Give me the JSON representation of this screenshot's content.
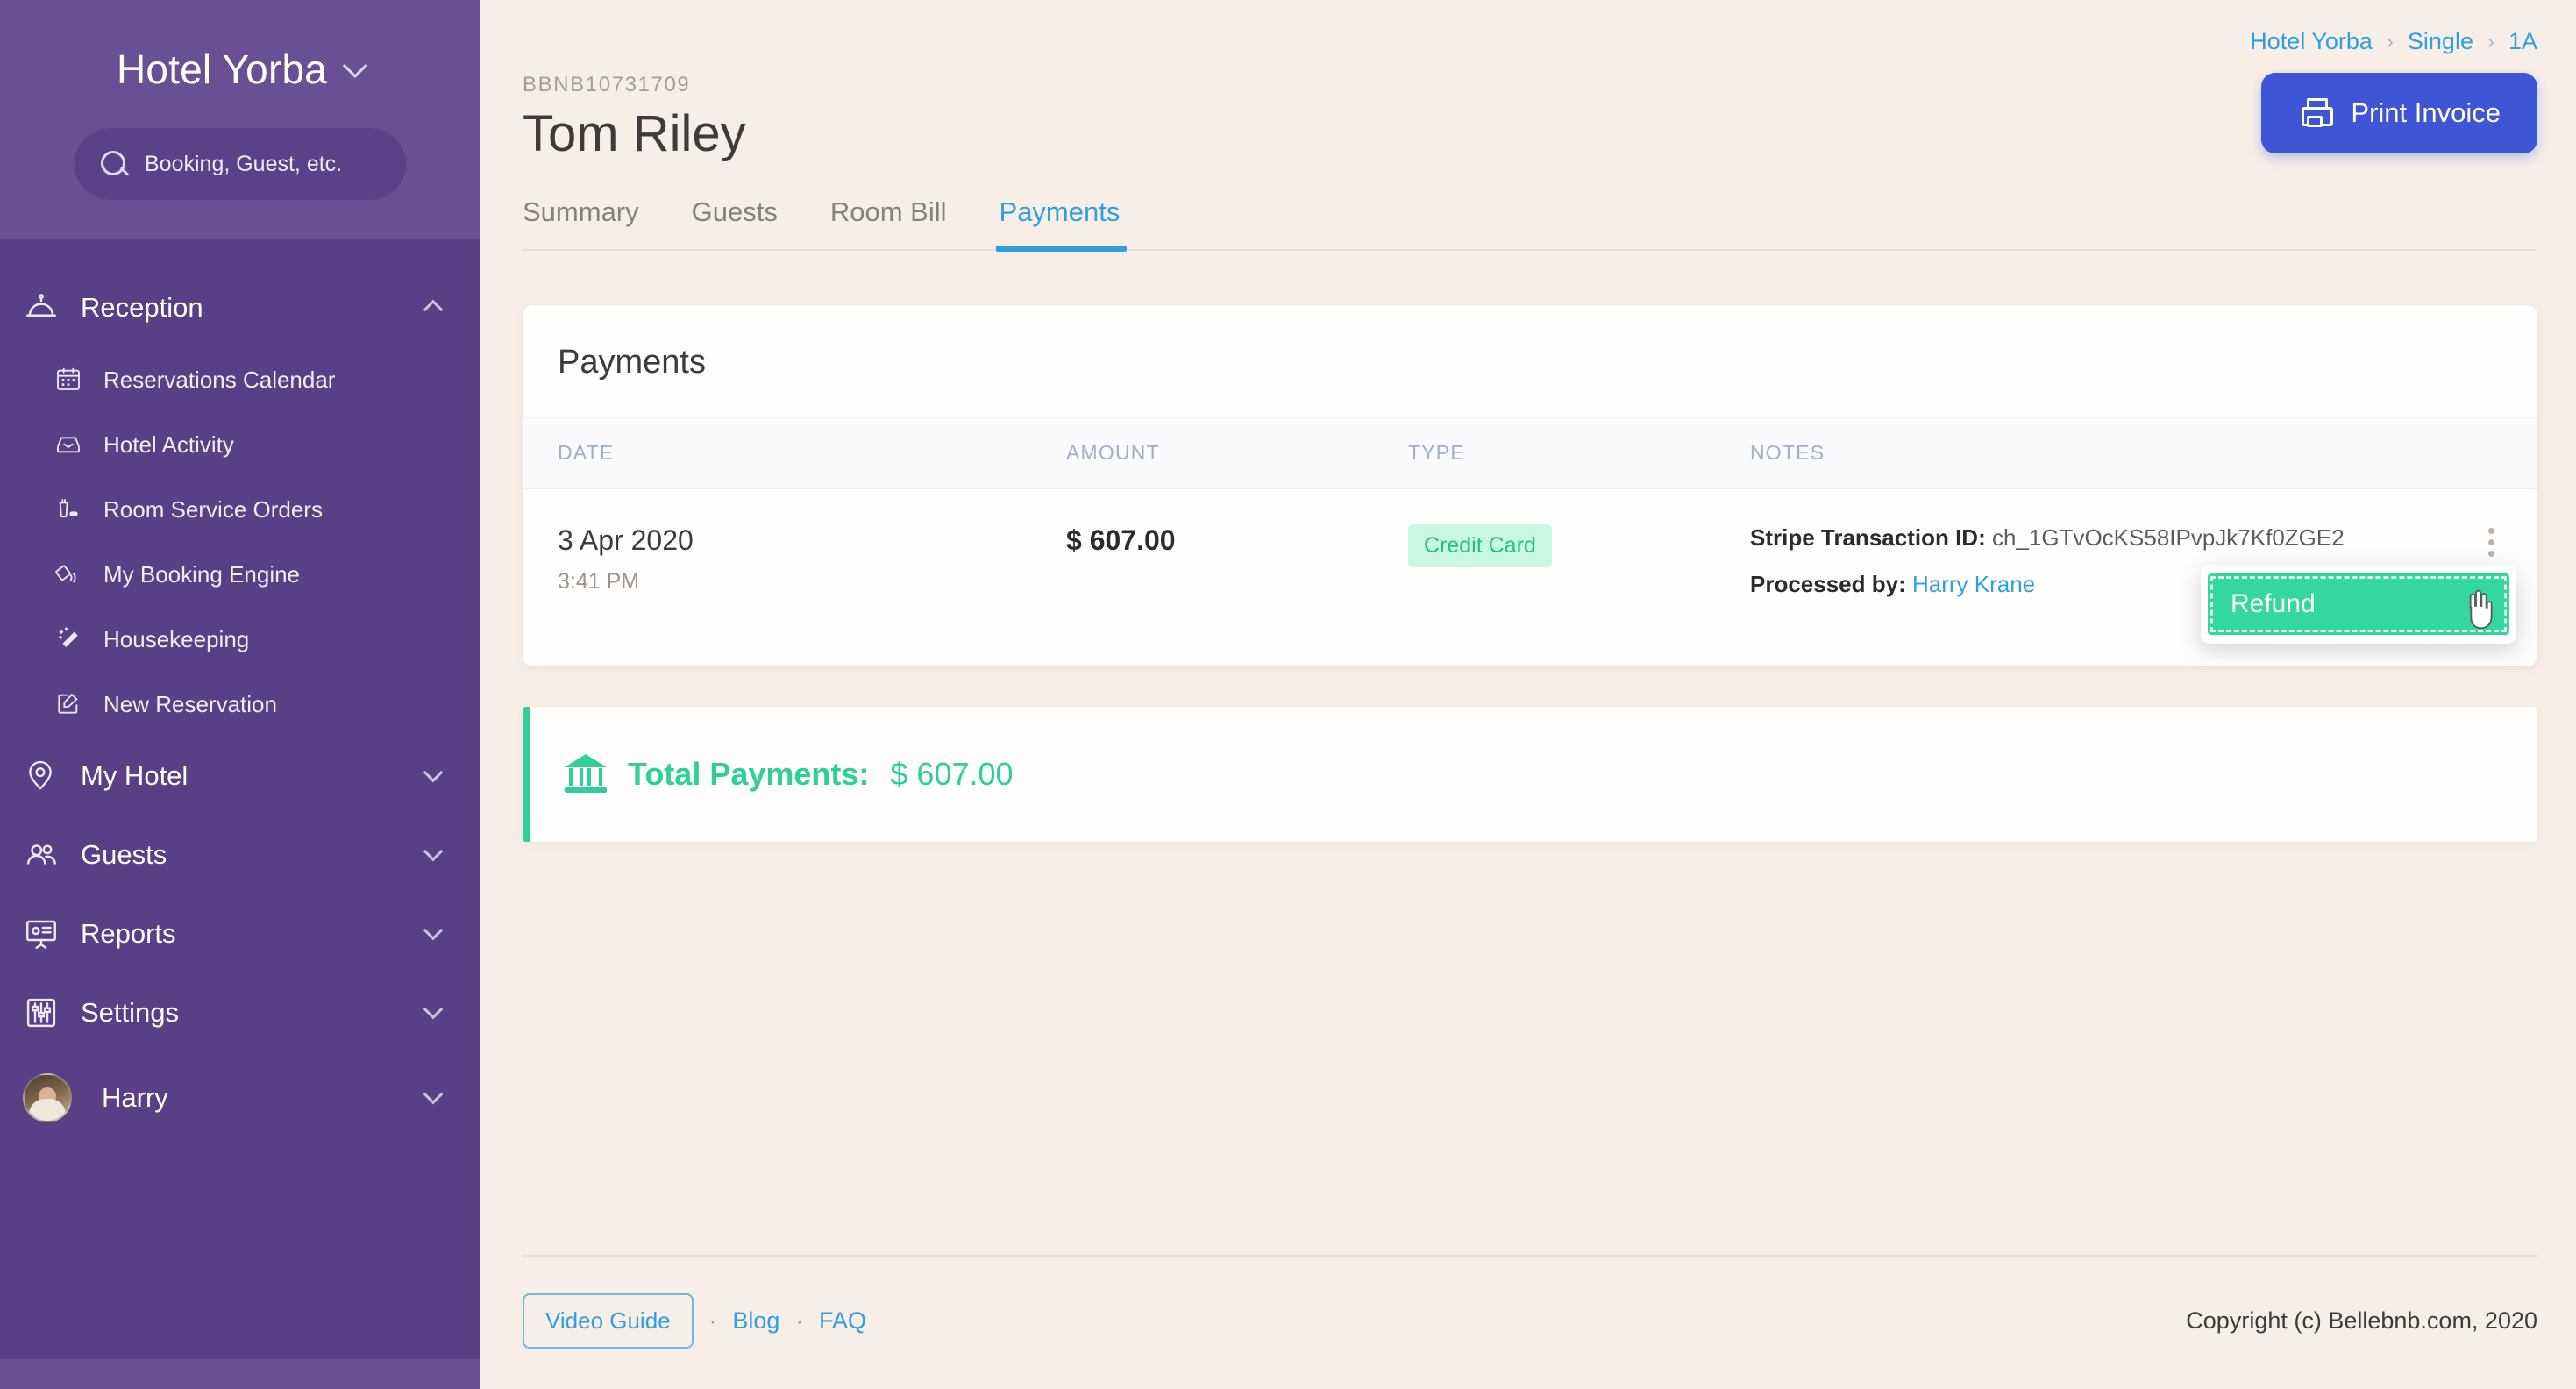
{
  "sidebar": {
    "brand": "Hotel Yorba",
    "brand_chevron_icon": "chevron-down-icon",
    "search": {
      "placeholder": "Booking, Guest, etc.",
      "icon": "search-icon"
    },
    "groups": [
      {
        "label": "Reception",
        "icon": "service-bell-icon",
        "expanded": true,
        "chevron": "chevron-up-icon",
        "items": [
          {
            "label": "Reservations Calendar",
            "icon": "calendar-icon"
          },
          {
            "label": "Hotel Activity",
            "icon": "inbox-icon"
          },
          {
            "label": "Room Service Orders",
            "icon": "room-service-icon"
          },
          {
            "label": "My Booking Engine",
            "icon": "booking-engine-icon"
          },
          {
            "label": "Housekeeping",
            "icon": "magic-wand-icon"
          },
          {
            "label": "New Reservation",
            "icon": "edit-square-icon"
          }
        ]
      },
      {
        "label": "My Hotel",
        "icon": "map-pin-icon",
        "expanded": false,
        "chevron": "chevron-down-icon",
        "items": []
      },
      {
        "label": "Guests",
        "icon": "people-icon",
        "expanded": false,
        "chevron": "chevron-down-icon",
        "items": []
      },
      {
        "label": "Reports",
        "icon": "presentation-chart-icon",
        "expanded": false,
        "chevron": "chevron-down-icon",
        "items": []
      },
      {
        "label": "Settings",
        "icon": "sliders-icon",
        "expanded": false,
        "chevron": "chevron-down-icon",
        "items": []
      }
    ],
    "user": {
      "name": "Harry",
      "avatar": "user-avatar",
      "chevron": "chevron-down-icon"
    }
  },
  "breadcrumb": {
    "hotel": "Hotel Yorba",
    "room_type": "Single",
    "room": "1A",
    "separator": "›"
  },
  "header": {
    "booking_id": "BBNB10731709",
    "guest_name": "Tom Riley",
    "print_label": "Print Invoice",
    "print_icon": "printer-icon"
  },
  "tabs": [
    {
      "label": "Summary",
      "active": false
    },
    {
      "label": "Guests",
      "active": false
    },
    {
      "label": "Room Bill",
      "active": false
    },
    {
      "label": "Payments",
      "active": true
    }
  ],
  "payments_card": {
    "title": "Payments",
    "columns": [
      "DATE",
      "AMOUNT",
      "TYPE",
      "NOTES"
    ],
    "rows": [
      {
        "date": "3 Apr 2020",
        "time": "3:41 PM",
        "amount": "$ 607.00",
        "type": "Credit Card",
        "note_label_1": "Stripe Transaction ID:",
        "note_value_1": "ch_1GTvOcKS58IPvpJk7Kf0ZGE2",
        "note_label_2": "Processed by:",
        "note_value_2": "Harry Krane",
        "kebab_icon": "kebab-menu-icon"
      }
    ],
    "dropdown": {
      "open": true,
      "items": [
        {
          "label": "Refund",
          "highlighted": true
        }
      ]
    }
  },
  "total": {
    "icon": "bank-icon",
    "label": "Total Payments:",
    "value": "$ 607.00"
  },
  "footer": {
    "video_guide": "Video Guide",
    "blog": "Blog",
    "faq": "FAQ",
    "separator": "·",
    "copyright": "Copyright (c) Bellebnb.com, 2020"
  },
  "colors": {
    "sidebar": "#5b3f86",
    "sidebar_top": "#6b4f94",
    "background": "#f7efe7",
    "accent_blue": "#2f9fe0",
    "primary_button": "#3e55d6",
    "green": "#2ecf9a",
    "chip_bg": "#c8f7e2"
  }
}
